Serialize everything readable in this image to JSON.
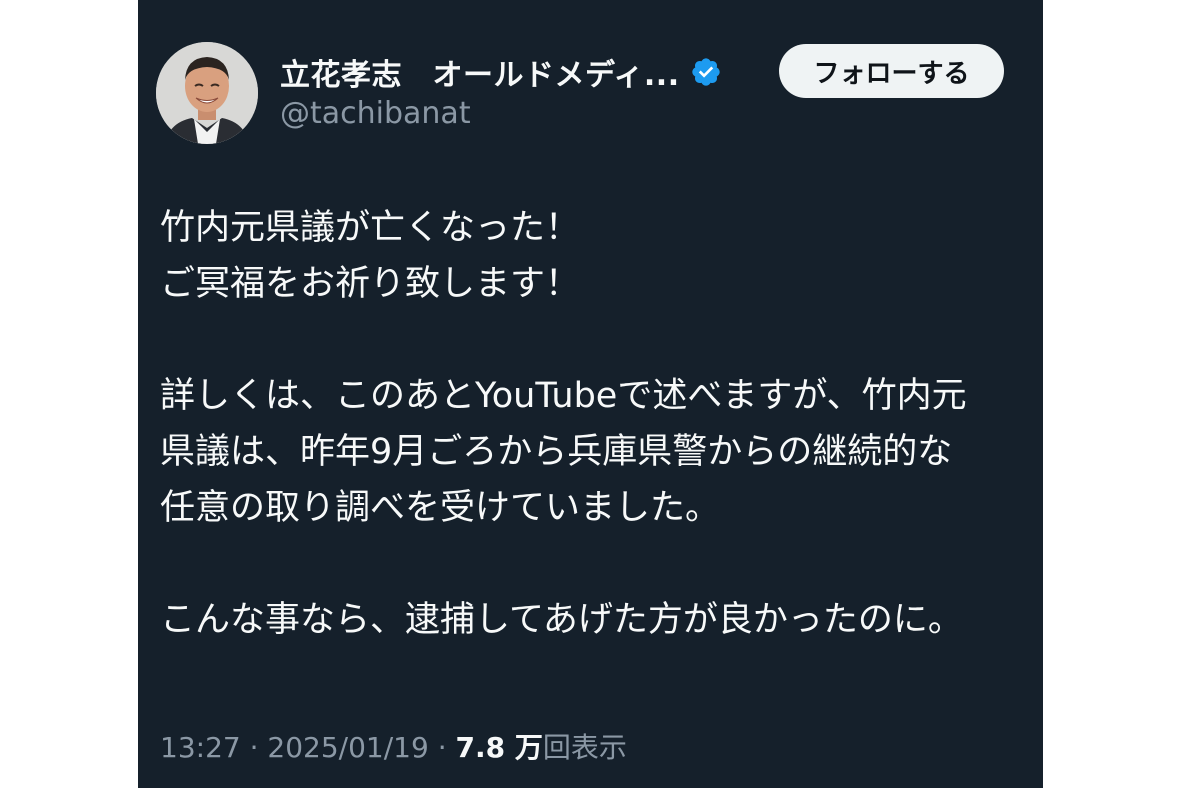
{
  "tweet": {
    "author": {
      "display_name": "立花孝志　オールドメディ...",
      "handle": "@tachibanat",
      "verified": true,
      "avatar_icon": "person-avatar"
    },
    "follow_button_label": "フォローする",
    "paragraphs": [
      "竹内元県議が亡くなった！\nご冥福をお祈り致します！",
      "詳しくは、このあとYouTubeで述べますが、竹内元\n県議は、昨年9月ごろから兵庫県警からの継続的な\n任意の取り調べを受けていました。",
      "こんな事なら、逮捕してあげた方が良かったのに。"
    ],
    "meta": {
      "time": "13:27",
      "separator": " · ",
      "date": "2025/01/19",
      "views_count": "7.8 万",
      "views_label": "回表示"
    }
  },
  "colors": {
    "background": "#15202b",
    "text_primary": "#f7f9f9",
    "text_secondary": "#8b98a5",
    "verified_badge": "#1d9bf0",
    "follow_button_bg": "#eff3f4"
  }
}
